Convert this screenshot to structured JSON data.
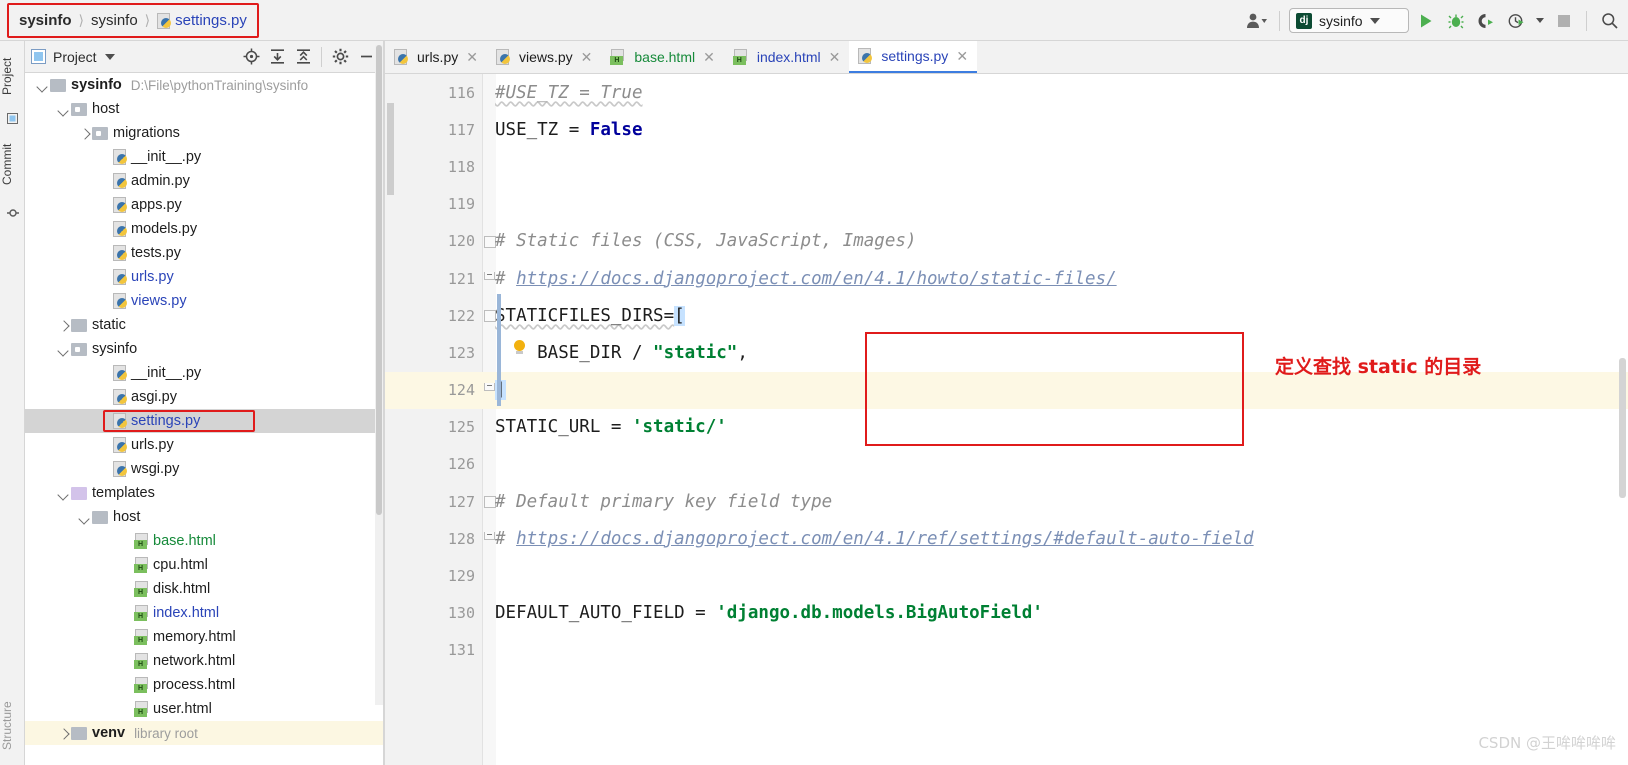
{
  "breadcrumb": {
    "items": [
      "sysinfo",
      "sysinfo"
    ],
    "file": "settings.py",
    "file_icon": "python-file-icon"
  },
  "toolbar": {
    "account_icon": "user-account-icon",
    "run_config": {
      "badge": "dj",
      "name": "sysinfo"
    },
    "run_icon": "run-icon",
    "debug_icon": "debug-icon",
    "run_coverage_icon": "run-with-coverage-icon",
    "profile_icon": "profile-icon",
    "stop_icon": "stop-icon",
    "search_icon": "search-everywhere-icon"
  },
  "left_strips": {
    "project_tab": "Project",
    "commit_tab": "Commit",
    "structure_tab": "Structure"
  },
  "project_panel": {
    "title": "Project",
    "locate_icon": "locate-icon",
    "expand_all_icon": "expand-all-icon",
    "collapse_all_icon": "collapse-all-icon",
    "settings_icon": "gear-icon",
    "hide_icon": "minimize-icon",
    "tree": [
      {
        "indent": 0,
        "twisty": "down",
        "icon": "folder",
        "label": "sysinfo",
        "bold": true,
        "path": "D:\\File\\pythonTraining\\sysinfo"
      },
      {
        "indent": 1,
        "twisty": "down",
        "icon": "folder-module",
        "label": "host"
      },
      {
        "indent": 2,
        "twisty": "right",
        "icon": "folder-module",
        "label": "migrations"
      },
      {
        "indent": 3,
        "twisty": "none",
        "icon": "python",
        "label": "__init__.py"
      },
      {
        "indent": 3,
        "twisty": "none",
        "icon": "python",
        "label": "admin.py"
      },
      {
        "indent": 3,
        "twisty": "none",
        "icon": "python",
        "label": "apps.py"
      },
      {
        "indent": 3,
        "twisty": "none",
        "icon": "python",
        "label": "models.py"
      },
      {
        "indent": 3,
        "twisty": "none",
        "icon": "python",
        "label": "tests.py"
      },
      {
        "indent": 3,
        "twisty": "none",
        "icon": "python",
        "label": "urls.py",
        "color": "blue"
      },
      {
        "indent": 3,
        "twisty": "none",
        "icon": "python",
        "label": "views.py",
        "color": "blue"
      },
      {
        "indent": 1,
        "twisty": "right",
        "icon": "folder",
        "label": "static"
      },
      {
        "indent": 1,
        "twisty": "down",
        "icon": "folder-module",
        "label": "sysinfo"
      },
      {
        "indent": 3,
        "twisty": "none",
        "icon": "python",
        "label": "__init__.py"
      },
      {
        "indent": 3,
        "twisty": "none",
        "icon": "python",
        "label": "asgi.py"
      },
      {
        "indent": 3,
        "twisty": "none",
        "icon": "python",
        "label": "settings.py",
        "color": "blue",
        "selected": true,
        "boxed": true
      },
      {
        "indent": 3,
        "twisty": "none",
        "icon": "python",
        "label": "urls.py"
      },
      {
        "indent": 3,
        "twisty": "none",
        "icon": "python",
        "label": "wsgi.py"
      },
      {
        "indent": 1,
        "twisty": "down",
        "icon": "folder-templates",
        "label": "templates"
      },
      {
        "indent": 2,
        "twisty": "down",
        "icon": "folder",
        "label": "host"
      },
      {
        "indent": 4,
        "twisty": "none",
        "icon": "html",
        "label": "base.html",
        "color": "green"
      },
      {
        "indent": 4,
        "twisty": "none",
        "icon": "html",
        "label": "cpu.html"
      },
      {
        "indent": 4,
        "twisty": "none",
        "icon": "html",
        "label": "disk.html"
      },
      {
        "indent": 4,
        "twisty": "none",
        "icon": "html",
        "label": "index.html",
        "color": "blue"
      },
      {
        "indent": 4,
        "twisty": "none",
        "icon": "html",
        "label": "memory.html"
      },
      {
        "indent": 4,
        "twisty": "none",
        "icon": "html",
        "label": "network.html"
      },
      {
        "indent": 4,
        "twisty": "none",
        "icon": "html",
        "label": "process.html"
      },
      {
        "indent": 4,
        "twisty": "none",
        "icon": "html",
        "label": "user.html"
      },
      {
        "indent": 1,
        "twisty": "right",
        "icon": "folder",
        "label": "venv",
        "path2": "library root",
        "venv": true
      }
    ]
  },
  "editor": {
    "tabs": [
      {
        "label": "urls.py",
        "icon": "python",
        "color": "default",
        "active": false,
        "closable": true
      },
      {
        "label": "views.py",
        "icon": "python",
        "color": "default",
        "active": false,
        "closable": true
      },
      {
        "label": "base.html",
        "icon": "html",
        "color": "green",
        "active": false,
        "closable": true
      },
      {
        "label": "index.html",
        "icon": "html",
        "color": "blue",
        "active": false,
        "closable": true
      },
      {
        "label": "settings.py",
        "icon": "python",
        "color": "blue",
        "active": true,
        "closable": true
      }
    ],
    "lines": [
      {
        "no": "116",
        "type": "comment-squiggle",
        "text": "#USE_TZ = True"
      },
      {
        "no": "117",
        "type": "assign-keyword",
        "name": "USE_TZ",
        "op": " = ",
        "value": "False"
      },
      {
        "no": "118",
        "type": "blank",
        "text": ""
      },
      {
        "no": "119",
        "type": "blank",
        "text": ""
      },
      {
        "no": "120",
        "type": "comment-fold",
        "text": "# Static files (CSS, JavaScript, Images)"
      },
      {
        "no": "121",
        "type": "comment-link",
        "text": "# https://docs.djangoproject.com/en/4.1/howto/static-files/"
      },
      {
        "no": "122",
        "type": "code-bracket",
        "text": "STATICFILES_DIRS=["
      },
      {
        "no": "123",
        "type": "code-str",
        "prefix": "    BASE_DIR / ",
        "str": "\"static\"",
        "suffix": ","
      },
      {
        "no": "124",
        "type": "code-close",
        "text": "]",
        "highlight": true
      },
      {
        "no": "125",
        "type": "code-str2",
        "prefix": "STATIC_URL = ",
        "str": "'static/'"
      },
      {
        "no": "126",
        "type": "blank",
        "text": ""
      },
      {
        "no": "127",
        "type": "comment-fold",
        "text": "# Default primary key field type"
      },
      {
        "no": "128",
        "type": "comment-link",
        "text": "# https://docs.djangoproject.com/en/4.1/ref/settings/#default-auto-field"
      },
      {
        "no": "129",
        "type": "blank",
        "text": ""
      },
      {
        "no": "130",
        "type": "code-str2",
        "prefix": "DEFAULT_AUTO_FIELD = ",
        "str": "'django.db.models.BigAutoField'"
      },
      {
        "no": "131",
        "type": "blank",
        "text": ""
      }
    ],
    "annotation": {
      "text": "定义查找 static 的目录",
      "color": "#e01b1b"
    }
  },
  "watermark": "CSDN @王哞哞哞哞",
  "colors": {
    "accent": "#2a44b8",
    "annotation_red": "#e01b1b",
    "string_green": "#008033",
    "keyword_blue": "#00009b",
    "comment_gray": "#8c8c8c",
    "highlight_yellow": "#fdf8e4"
  }
}
